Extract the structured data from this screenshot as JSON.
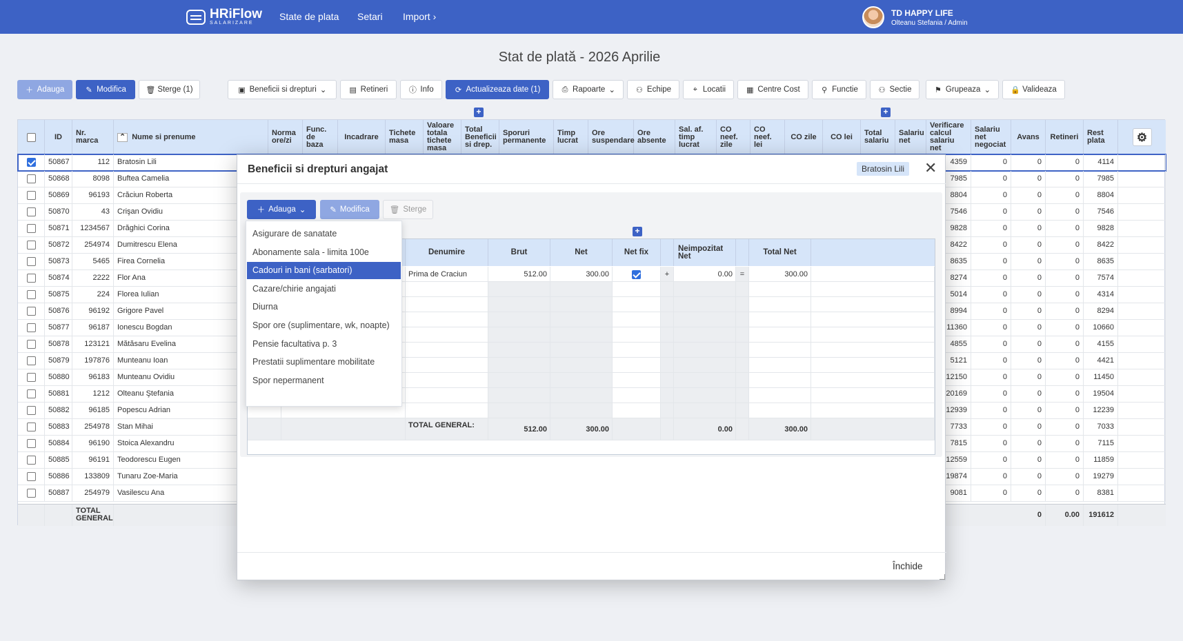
{
  "app": {
    "logo": "HRiFlow",
    "logo_sub": "SALARIZARE"
  },
  "nav": {
    "items": [
      "State de plata",
      "Setari",
      "Import"
    ]
  },
  "user": {
    "company": "TD HAPPY LIFE",
    "role": "Olteanu Stefania / Admin"
  },
  "page": {
    "title": "Stat de plată - 2026 Aprilie"
  },
  "toolbar": {
    "add": "Adauga",
    "edit": "Modifica",
    "delete": "Sterge (1)",
    "benefits": "Beneficii si drepturi",
    "retineri": "Retineri",
    "info": "Info",
    "update": "Actualizeaza date (1)",
    "rapoarte": "Rapoarte",
    "echipe": "Echipe",
    "locatii": "Locatii",
    "centre": "Centre Cost",
    "functie": "Functie",
    "sectie": "Sectie",
    "grupeaza": "Grupeaza",
    "valideaza": "Valideaza"
  },
  "grid": {
    "headers": {
      "id": "ID",
      "marca": "Nr. marca",
      "nume": "Nume si prenume",
      "norma": "Norma ore/zi",
      "func": "Func. de baza",
      "incadrare": "Incadrare",
      "tichete": "Tichete masa",
      "val_tichete": "Valoare totala tichete masa",
      "total_ben": "Total Beneficii si drep.",
      "sporuri": "Sporuri permanente",
      "timp": "Timp lucrat",
      "ore_susp": "Ore suspendare",
      "ore_abs": "Ore absente",
      "sal_af": "Sal. af. timp lucrat",
      "co_zile_neef": "CO neef. zile",
      "co_lei_neef": "CO neef. lei",
      "co_zile": "CO zile",
      "co_lei": "CO lei",
      "total_sal": "Total salariu",
      "sal_net": "Salariu net",
      "verif": "Verificare calcul salariu net",
      "net_neg": "Salariu net negociat",
      "avans": "Avans",
      "retineri": "Retineri",
      "rest": "Rest plata"
    },
    "rows": [
      {
        "id": "50867",
        "marca": "112",
        "nume": "Bratosin Lili",
        "verif": "4359",
        "net_neg": "0",
        "avans": "0",
        "ret": "0",
        "rest": "4114",
        "checked": true
      },
      {
        "id": "50868",
        "marca": "8098",
        "nume": "Buftea Camelia",
        "verif": "7985",
        "net_neg": "0",
        "avans": "0",
        "ret": "0",
        "rest": "7985",
        "checked": false
      },
      {
        "id": "50869",
        "marca": "96193",
        "nume": "Crăciun Roberta",
        "verif": "8804",
        "net_neg": "0",
        "avans": "0",
        "ret": "0",
        "rest": "8804",
        "checked": false
      },
      {
        "id": "50870",
        "marca": "43",
        "nume": "Crişan Ovidiu",
        "verif": "7546",
        "net_neg": "0",
        "avans": "0",
        "ret": "0",
        "rest": "7546",
        "checked": false
      },
      {
        "id": "50871",
        "marca": "1234567",
        "nume": "Drăghici Corina",
        "verif": "9828",
        "net_neg": "0",
        "avans": "0",
        "ret": "0",
        "rest": "9828",
        "checked": false
      },
      {
        "id": "50872",
        "marca": "254974",
        "nume": "Dumitrescu Elena",
        "verif": "8422",
        "net_neg": "0",
        "avans": "0",
        "ret": "0",
        "rest": "8422",
        "checked": false
      },
      {
        "id": "50873",
        "marca": "5465",
        "nume": "Firea Cornelia",
        "verif": "8635",
        "net_neg": "0",
        "avans": "0",
        "ret": "0",
        "rest": "8635",
        "checked": false
      },
      {
        "id": "50874",
        "marca": "2222",
        "nume": "Flor Ana",
        "verif": "8274",
        "net_neg": "0",
        "avans": "0",
        "ret": "0",
        "rest": "7574",
        "checked": false
      },
      {
        "id": "50875",
        "marca": "224",
        "nume": "Florea Iulian",
        "verif": "5014",
        "net_neg": "0",
        "avans": "0",
        "ret": "0",
        "rest": "4314",
        "checked": false
      },
      {
        "id": "50876",
        "marca": "96192",
        "nume": "Grigore Pavel",
        "verif": "8994",
        "net_neg": "0",
        "avans": "0",
        "ret": "0",
        "rest": "8294",
        "checked": false
      },
      {
        "id": "50877",
        "marca": "96187",
        "nume": "Ionescu Bogdan",
        "verif": "11360",
        "net_neg": "0",
        "avans": "0",
        "ret": "0",
        "rest": "10660",
        "checked": false
      },
      {
        "id": "50878",
        "marca": "123121",
        "nume": "Mătăsaru Evelina",
        "verif": "4855",
        "net_neg": "0",
        "avans": "0",
        "ret": "0",
        "rest": "4155",
        "checked": false
      },
      {
        "id": "50879",
        "marca": "197876",
        "nume": "Munteanu Ioan",
        "verif": "5121",
        "net_neg": "0",
        "avans": "0",
        "ret": "0",
        "rest": "4421",
        "checked": false
      },
      {
        "id": "50880",
        "marca": "96183",
        "nume": "Munteanu Ovidiu",
        "verif": "12150",
        "net_neg": "0",
        "avans": "0",
        "ret": "0",
        "rest": "11450",
        "checked": false
      },
      {
        "id": "50881",
        "marca": "1212",
        "nume": "Olteanu Ştefania",
        "verif": "20169",
        "net_neg": "0",
        "avans": "0",
        "ret": "0",
        "rest": "19504",
        "checked": false
      },
      {
        "id": "50882",
        "marca": "96185",
        "nume": "Popescu Adrian",
        "verif": "12939",
        "net_neg": "0",
        "avans": "0",
        "ret": "0",
        "rest": "12239",
        "checked": false
      },
      {
        "id": "50883",
        "marca": "254978",
        "nume": "Stan Mihai",
        "verif": "7733",
        "net_neg": "0",
        "avans": "0",
        "ret": "0",
        "rest": "7033",
        "checked": false
      },
      {
        "id": "50884",
        "marca": "96190",
        "nume": "Stoica Alexandru",
        "verif": "7815",
        "net_neg": "0",
        "avans": "0",
        "ret": "0",
        "rest": "7115",
        "checked": false
      },
      {
        "id": "50885",
        "marca": "96191",
        "nume": "Teodorescu Eugen",
        "verif": "12559",
        "net_neg": "0",
        "avans": "0",
        "ret": "0",
        "rest": "11859",
        "checked": false
      },
      {
        "id": "50886",
        "marca": "133809",
        "nume": "Tunaru Zoe-Maria",
        "verif": "19874",
        "net_neg": "0",
        "avans": "0",
        "ret": "0",
        "rest": "19279",
        "checked": false
      },
      {
        "id": "50887",
        "marca": "254979",
        "nume": "Vasilescu Ana",
        "verif": "9081",
        "net_neg": "0",
        "avans": "0",
        "ret": "0",
        "rest": "8381",
        "checked": false
      }
    ],
    "footer": {
      "label": "TOTAL GENERAL:",
      "avans": "0",
      "retineri": "0.00",
      "rest": "191612"
    }
  },
  "modal": {
    "title": "Beneficii si drepturi angajat",
    "employee": "Bratosin Lili",
    "add": "Adauga",
    "edit": "Modifica",
    "delete": "Sterge",
    "close": "Închide",
    "dropdown": [
      "Asigurare de sanatate",
      "Abonamente sala - limita 100e",
      "Cadouri in bani (sarbatori)",
      "Cazare/chirie angajati",
      "Diurna",
      "Spor ore (suplimentare, wk, noapte)",
      "Pensie facultativa p. 3",
      "Prestatii suplimentare mobilitate",
      "Spor nepermanent"
    ],
    "table": {
      "headers": {
        "denumire": "Denumire",
        "brut": "Brut",
        "net": "Net",
        "netfix": "Net fix",
        "neimp": "Neimpozitat Net",
        "total": "Total Net"
      },
      "row": {
        "denumire": "Prima de Craciun",
        "brut": "512.00",
        "net": "300.00",
        "plus": "+",
        "neimp": "0.00",
        "eq": "=",
        "total": "300.00"
      },
      "footer": {
        "label": "TOTAL GENERAL:",
        "brut": "512.00",
        "net": "300.00",
        "neimp": "0.00",
        "total": "300.00"
      }
    }
  }
}
